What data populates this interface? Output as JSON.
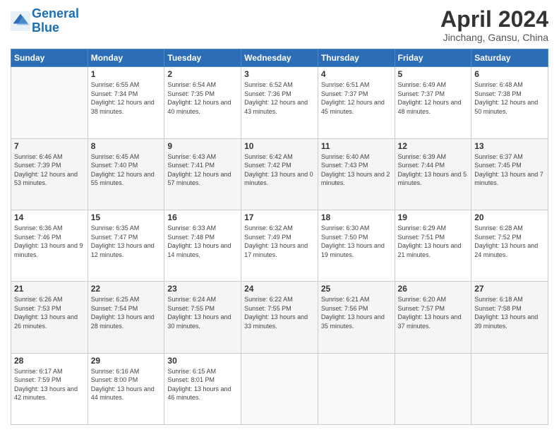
{
  "header": {
    "logo_general": "General",
    "logo_blue": "Blue",
    "title": "April 2024",
    "location": "Jinchang, Gansu, China"
  },
  "weekdays": [
    "Sunday",
    "Monday",
    "Tuesday",
    "Wednesday",
    "Thursday",
    "Friday",
    "Saturday"
  ],
  "weeks": [
    [
      {
        "day": "",
        "sunrise": "",
        "sunset": "",
        "daylight": ""
      },
      {
        "day": "1",
        "sunrise": "Sunrise: 6:55 AM",
        "sunset": "Sunset: 7:34 PM",
        "daylight": "Daylight: 12 hours and 38 minutes."
      },
      {
        "day": "2",
        "sunrise": "Sunrise: 6:54 AM",
        "sunset": "Sunset: 7:35 PM",
        "daylight": "Daylight: 12 hours and 40 minutes."
      },
      {
        "day": "3",
        "sunrise": "Sunrise: 6:52 AM",
        "sunset": "Sunset: 7:36 PM",
        "daylight": "Daylight: 12 hours and 43 minutes."
      },
      {
        "day": "4",
        "sunrise": "Sunrise: 6:51 AM",
        "sunset": "Sunset: 7:37 PM",
        "daylight": "Daylight: 12 hours and 45 minutes."
      },
      {
        "day": "5",
        "sunrise": "Sunrise: 6:49 AM",
        "sunset": "Sunset: 7:37 PM",
        "daylight": "Daylight: 12 hours and 48 minutes."
      },
      {
        "day": "6",
        "sunrise": "Sunrise: 6:48 AM",
        "sunset": "Sunset: 7:38 PM",
        "daylight": "Daylight: 12 hours and 50 minutes."
      }
    ],
    [
      {
        "day": "7",
        "sunrise": "Sunrise: 6:46 AM",
        "sunset": "Sunset: 7:39 PM",
        "daylight": "Daylight: 12 hours and 53 minutes."
      },
      {
        "day": "8",
        "sunrise": "Sunrise: 6:45 AM",
        "sunset": "Sunset: 7:40 PM",
        "daylight": "Daylight: 12 hours and 55 minutes."
      },
      {
        "day": "9",
        "sunrise": "Sunrise: 6:43 AM",
        "sunset": "Sunset: 7:41 PM",
        "daylight": "Daylight: 12 hours and 57 minutes."
      },
      {
        "day": "10",
        "sunrise": "Sunrise: 6:42 AM",
        "sunset": "Sunset: 7:42 PM",
        "daylight": "Daylight: 13 hours and 0 minutes."
      },
      {
        "day": "11",
        "sunrise": "Sunrise: 6:40 AM",
        "sunset": "Sunset: 7:43 PM",
        "daylight": "Daylight: 13 hours and 2 minutes."
      },
      {
        "day": "12",
        "sunrise": "Sunrise: 6:39 AM",
        "sunset": "Sunset: 7:44 PM",
        "daylight": "Daylight: 13 hours and 5 minutes."
      },
      {
        "day": "13",
        "sunrise": "Sunrise: 6:37 AM",
        "sunset": "Sunset: 7:45 PM",
        "daylight": "Daylight: 13 hours and 7 minutes."
      }
    ],
    [
      {
        "day": "14",
        "sunrise": "Sunrise: 6:36 AM",
        "sunset": "Sunset: 7:46 PM",
        "daylight": "Daylight: 13 hours and 9 minutes."
      },
      {
        "day": "15",
        "sunrise": "Sunrise: 6:35 AM",
        "sunset": "Sunset: 7:47 PM",
        "daylight": "Daylight: 13 hours and 12 minutes."
      },
      {
        "day": "16",
        "sunrise": "Sunrise: 6:33 AM",
        "sunset": "Sunset: 7:48 PM",
        "daylight": "Daylight: 13 hours and 14 minutes."
      },
      {
        "day": "17",
        "sunrise": "Sunrise: 6:32 AM",
        "sunset": "Sunset: 7:49 PM",
        "daylight": "Daylight: 13 hours and 17 minutes."
      },
      {
        "day": "18",
        "sunrise": "Sunrise: 6:30 AM",
        "sunset": "Sunset: 7:50 PM",
        "daylight": "Daylight: 13 hours and 19 minutes."
      },
      {
        "day": "19",
        "sunrise": "Sunrise: 6:29 AM",
        "sunset": "Sunset: 7:51 PM",
        "daylight": "Daylight: 13 hours and 21 minutes."
      },
      {
        "day": "20",
        "sunrise": "Sunrise: 6:28 AM",
        "sunset": "Sunset: 7:52 PM",
        "daylight": "Daylight: 13 hours and 24 minutes."
      }
    ],
    [
      {
        "day": "21",
        "sunrise": "Sunrise: 6:26 AM",
        "sunset": "Sunset: 7:53 PM",
        "daylight": "Daylight: 13 hours and 26 minutes."
      },
      {
        "day": "22",
        "sunrise": "Sunrise: 6:25 AM",
        "sunset": "Sunset: 7:54 PM",
        "daylight": "Daylight: 13 hours and 28 minutes."
      },
      {
        "day": "23",
        "sunrise": "Sunrise: 6:24 AM",
        "sunset": "Sunset: 7:55 PM",
        "daylight": "Daylight: 13 hours and 30 minutes."
      },
      {
        "day": "24",
        "sunrise": "Sunrise: 6:22 AM",
        "sunset": "Sunset: 7:55 PM",
        "daylight": "Daylight: 13 hours and 33 minutes."
      },
      {
        "day": "25",
        "sunrise": "Sunrise: 6:21 AM",
        "sunset": "Sunset: 7:56 PM",
        "daylight": "Daylight: 13 hours and 35 minutes."
      },
      {
        "day": "26",
        "sunrise": "Sunrise: 6:20 AM",
        "sunset": "Sunset: 7:57 PM",
        "daylight": "Daylight: 13 hours and 37 minutes."
      },
      {
        "day": "27",
        "sunrise": "Sunrise: 6:18 AM",
        "sunset": "Sunset: 7:58 PM",
        "daylight": "Daylight: 13 hours and 39 minutes."
      }
    ],
    [
      {
        "day": "28",
        "sunrise": "Sunrise: 6:17 AM",
        "sunset": "Sunset: 7:59 PM",
        "daylight": "Daylight: 13 hours and 42 minutes."
      },
      {
        "day": "29",
        "sunrise": "Sunrise: 6:16 AM",
        "sunset": "Sunset: 8:00 PM",
        "daylight": "Daylight: 13 hours and 44 minutes."
      },
      {
        "day": "30",
        "sunrise": "Sunrise: 6:15 AM",
        "sunset": "Sunset: 8:01 PM",
        "daylight": "Daylight: 13 hours and 46 minutes."
      },
      {
        "day": "",
        "sunrise": "",
        "sunset": "",
        "daylight": ""
      },
      {
        "day": "",
        "sunrise": "",
        "sunset": "",
        "daylight": ""
      },
      {
        "day": "",
        "sunrise": "",
        "sunset": "",
        "daylight": ""
      },
      {
        "day": "",
        "sunrise": "",
        "sunset": "",
        "daylight": ""
      }
    ]
  ]
}
